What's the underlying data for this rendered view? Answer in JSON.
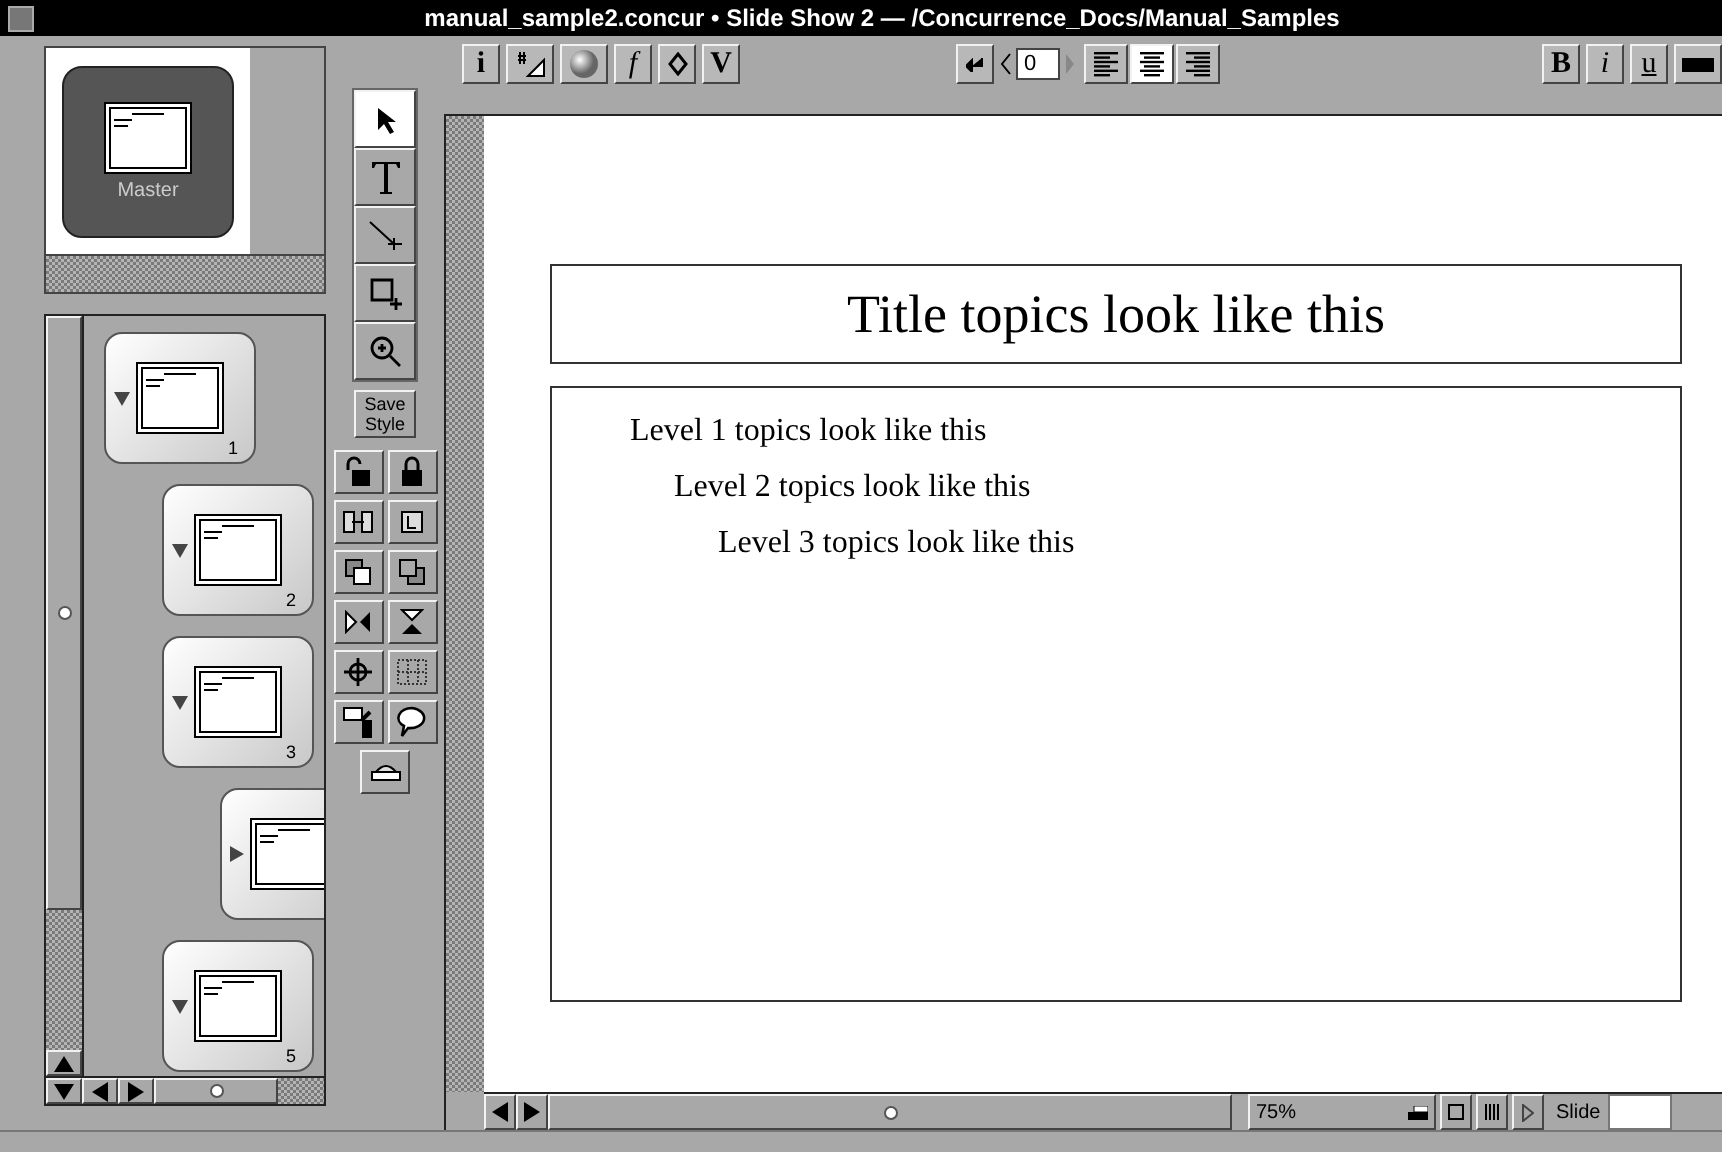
{
  "window": {
    "title": "manual_sample2.concur • Slide Show 2 — /Concurrence_Docs/Manual_Samples"
  },
  "toolbar": {
    "insert": [
      {
        "kind": "info",
        "label": "i"
      },
      {
        "kind": "numbering"
      },
      {
        "kind": "sphere"
      },
      {
        "kind": "formula",
        "label": "f"
      },
      {
        "kind": "diamond"
      },
      {
        "kind": "variable",
        "label": "V"
      }
    ],
    "indent": {
      "value": "0"
    },
    "alignment": [
      {
        "kind": "left",
        "selected": false
      },
      {
        "kind": "center",
        "selected": true
      },
      {
        "kind": "right",
        "selected": false
      }
    ],
    "text_style": [
      {
        "label": "B"
      },
      {
        "label": "i"
      },
      {
        "label": "u"
      }
    ]
  },
  "master": {
    "label": "Master"
  },
  "slides": [
    {
      "number": "1",
      "expanded": true,
      "children": [
        {
          "number": "2",
          "expanded": true
        },
        {
          "number": "3",
          "expanded": true,
          "children": [
            {
              "expanded": false
            }
          ]
        },
        {
          "number": "5",
          "expanded": true
        }
      ]
    }
  ],
  "tools": [
    {
      "kind": "pointer",
      "selected": true
    },
    {
      "kind": "text",
      "selected": false
    },
    {
      "kind": "line",
      "selected": false
    },
    {
      "kind": "rect",
      "selected": false
    },
    {
      "kind": "zoom",
      "selected": false
    }
  ],
  "save_style": {
    "label": "Save Style"
  },
  "actions": [
    {
      "kind": "unlock"
    },
    {
      "kind": "lock"
    },
    {
      "kind": "link"
    },
    {
      "kind": "unlink"
    },
    {
      "kind": "front"
    },
    {
      "kind": "back"
    },
    {
      "kind": "flip-h"
    },
    {
      "kind": "flip-v"
    },
    {
      "kind": "target"
    },
    {
      "kind": "grid"
    },
    {
      "kind": "presenter"
    },
    {
      "kind": "balloon"
    },
    {
      "kind": "stamp"
    }
  ],
  "slide": {
    "title": "Title topics look like this",
    "topics": [
      {
        "text": "Level 1 topics look like this",
        "children": [
          {
            "text": "Level 2 topics look like this",
            "children": [
              {
                "text": "Level 3 topics look like this"
              }
            ]
          }
        ]
      }
    ]
  },
  "status_bar": {
    "zoom": "75%",
    "slide_label": "Slide"
  }
}
